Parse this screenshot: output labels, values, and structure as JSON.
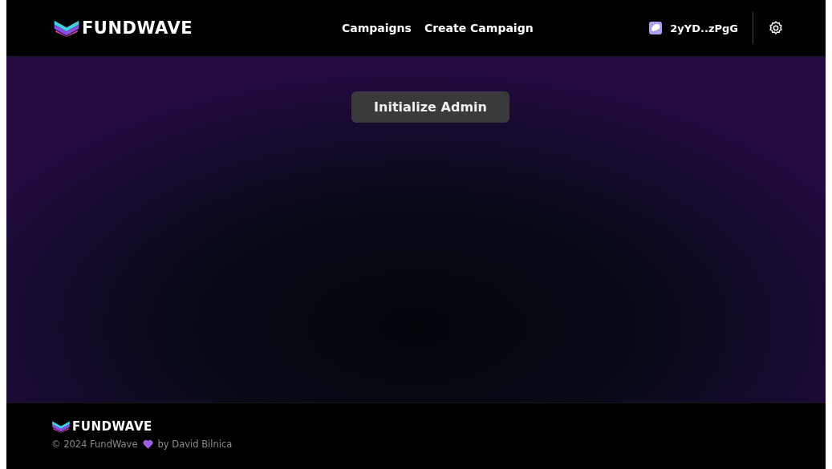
{
  "header": {
    "logo": "FUNDWAVE",
    "nav": [
      {
        "label": "Campaigns"
      },
      {
        "label": "Create Campaign"
      }
    ],
    "wallet": "2yYD..zPgG"
  },
  "main": {
    "button": "Initialize Admin"
  },
  "footer": {
    "logo": "FUNDWAVE",
    "copyright": "© 2024 FundWave",
    "credit": "by David Bilnica"
  }
}
